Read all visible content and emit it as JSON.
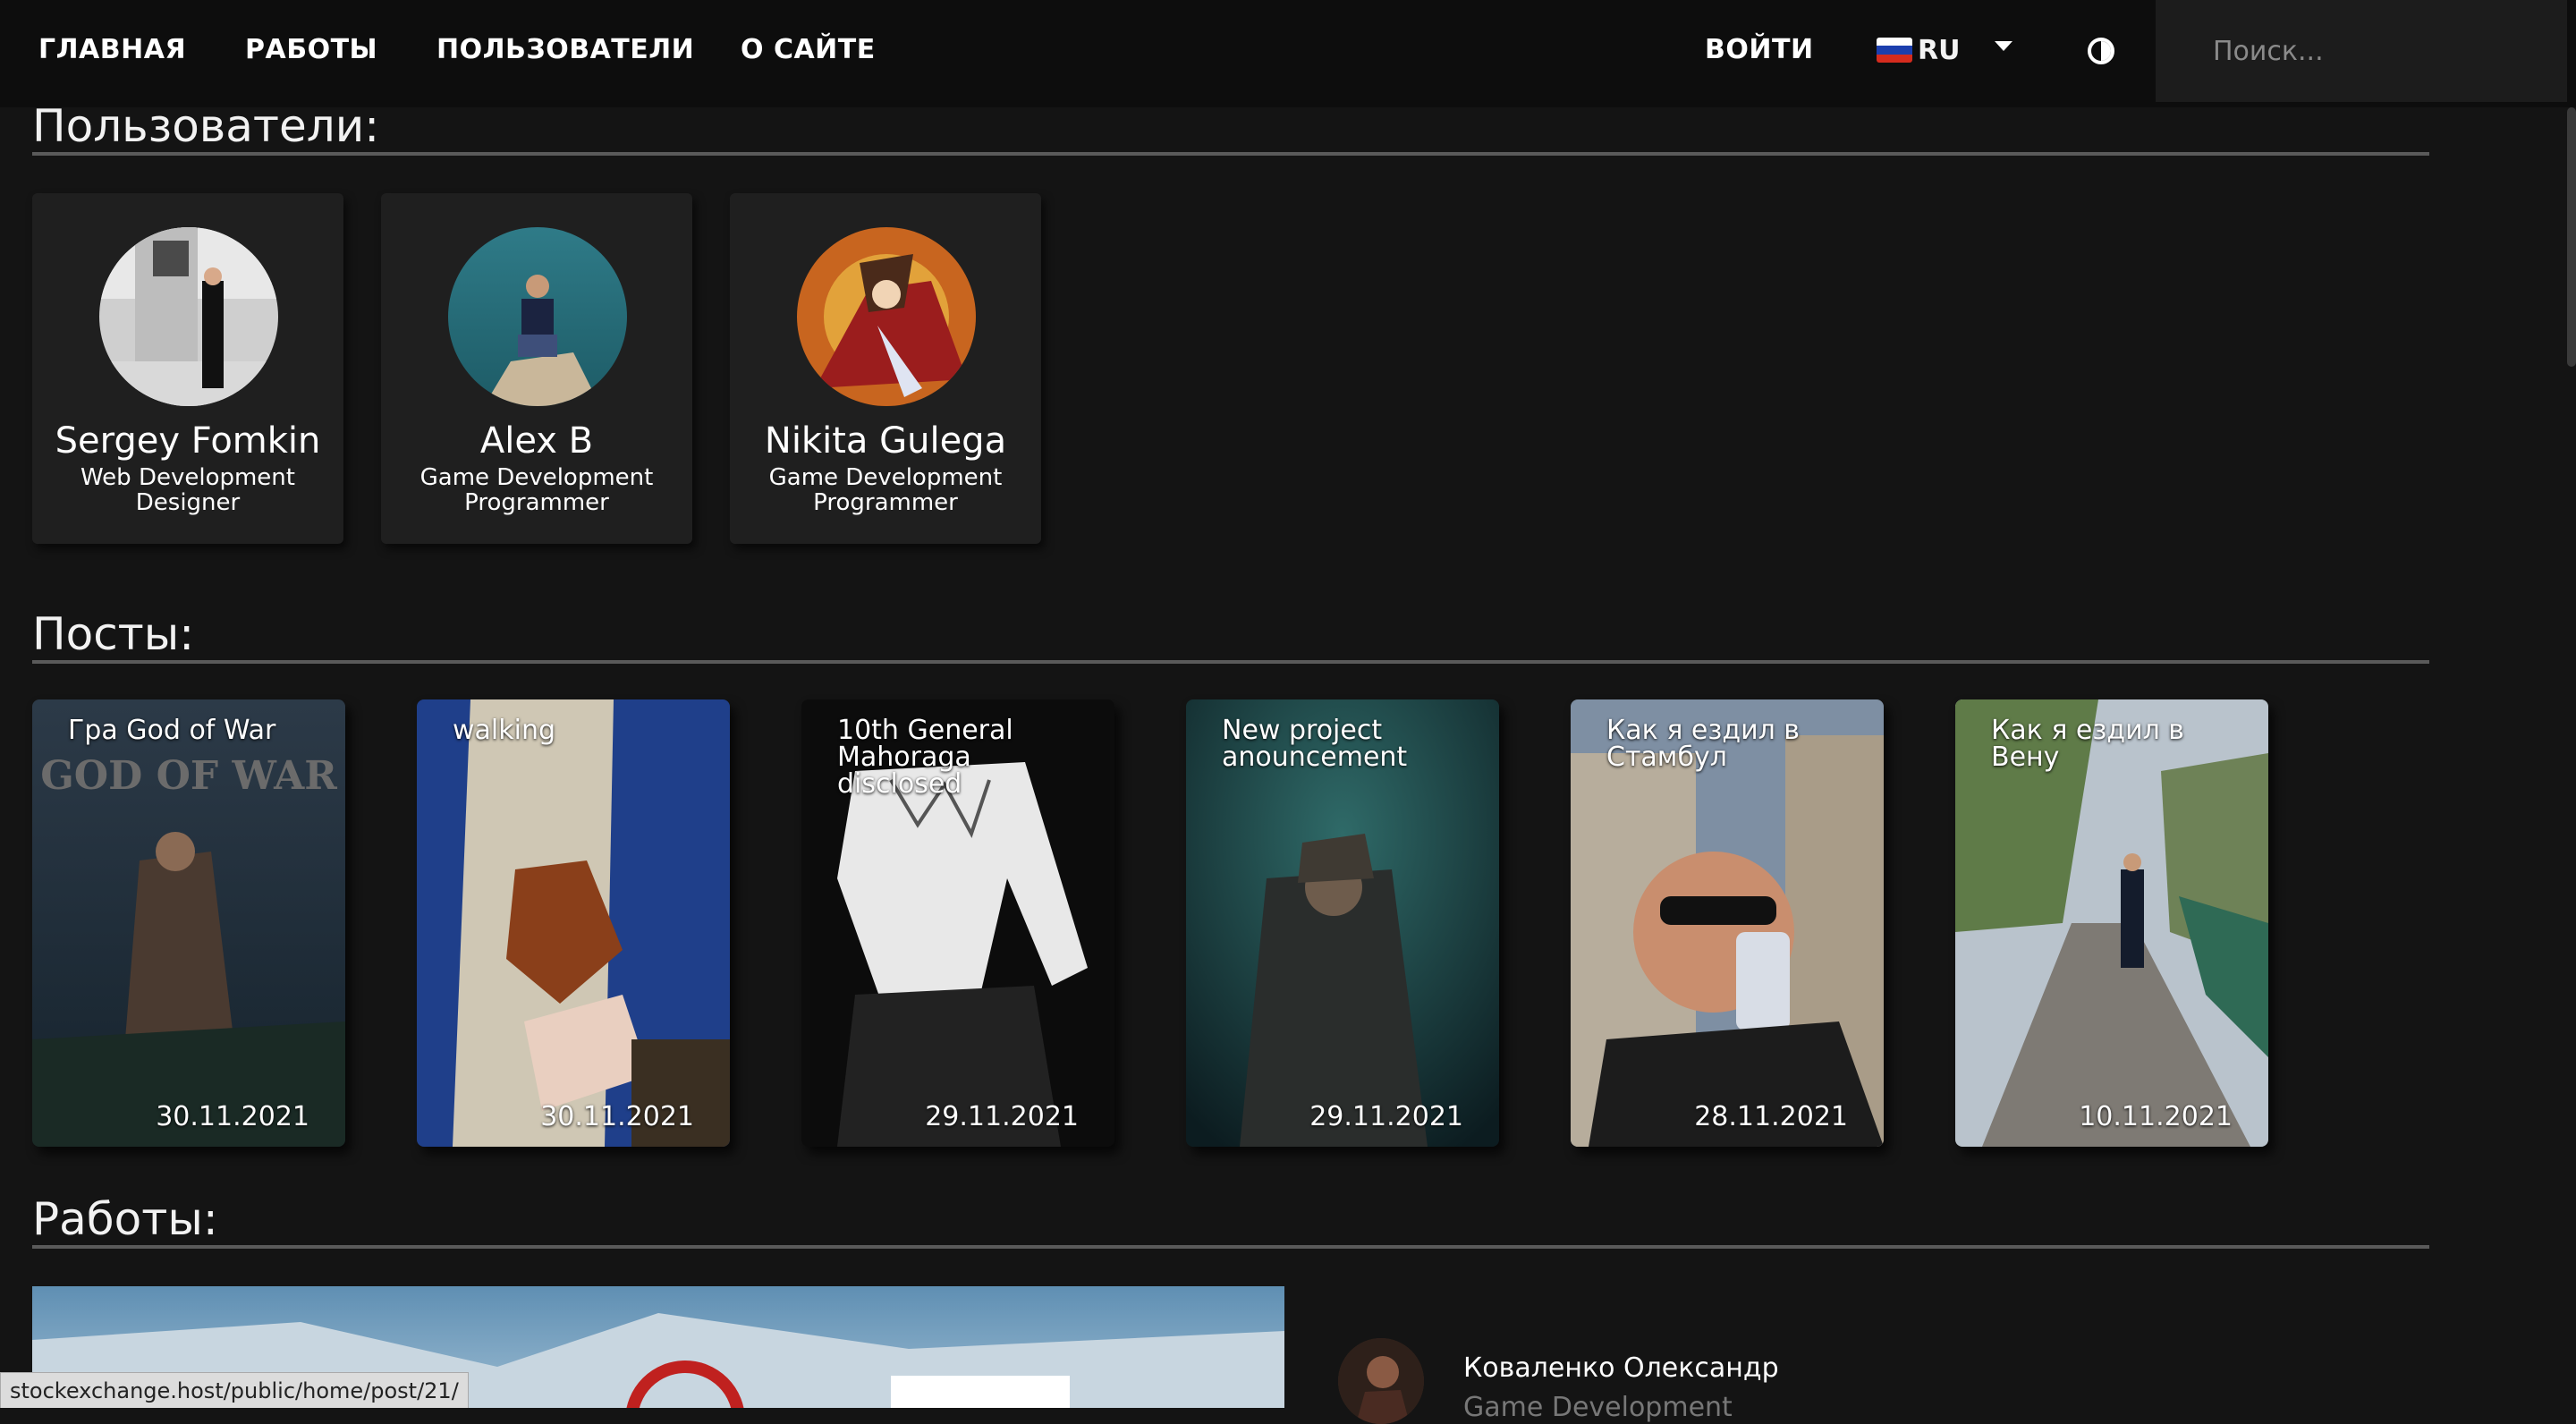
{
  "nav": {
    "home": "ГЛАВНАЯ",
    "works": "РАБОТЫ",
    "users": "ПОЛЬЗОВАТЕЛИ",
    "about": "О САЙТЕ",
    "login": "ВОЙТИ",
    "language": "RU",
    "search_placeholder": "Поиск..."
  },
  "users_section": {
    "title": "Пользователи:",
    "users": [
      {
        "name": "Sergey Fomkin",
        "role": "Web Development Designer"
      },
      {
        "name": "Alex B",
        "role": "Game Development Programmer"
      },
      {
        "name": "Nikita Gulega",
        "role": "Game Development Programmer"
      }
    ]
  },
  "posts_section": {
    "title": "Посты:",
    "posts": [
      {
        "title": "Гра God of War",
        "date": "30.11.2021"
      },
      {
        "title": "walking",
        "date": "30.11.2021"
      },
      {
        "title": "10th General Mahoraga disclosed",
        "date": "29.11.2021"
      },
      {
        "title": "New project anouncement",
        "date": "29.11.2021"
      },
      {
        "title": "Как я ездил в Стамбул",
        "date": "28.11.2021"
      },
      {
        "title": "Как я ездил в Вену",
        "date": "10.11.2021"
      }
    ]
  },
  "works_section": {
    "title": "Работы:",
    "author": "Коваленко Олександр",
    "category": "Game Development"
  },
  "status_bar": {
    "url": "stockexchange.host/public/home/post/21/"
  },
  "colors": {
    "background": "#141414",
    "navbar": "#0d0d0d",
    "card": "#1f1f1f"
  }
}
